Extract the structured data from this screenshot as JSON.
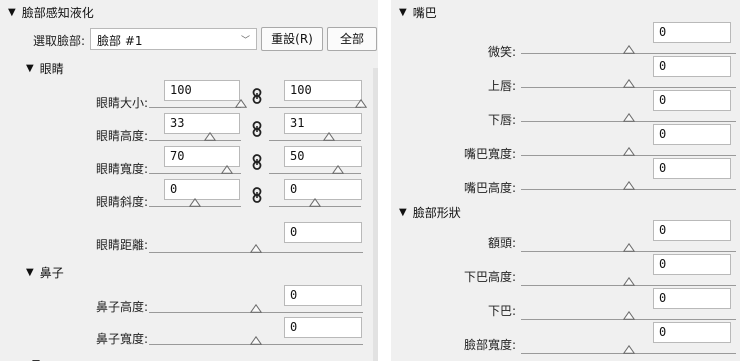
{
  "left": {
    "section_face": "臉部感知液化",
    "select_label": "選取臉部:",
    "select_value": "臉部 #1",
    "reset_button": "重設(R)",
    "all_button": "全部",
    "eyes": {
      "title": "眼睛",
      "rows": [
        {
          "label": "眼睛大小:",
          "left": "100",
          "right": "100",
          "left_level": 1.0,
          "right_level": 1.0
        },
        {
          "label": "眼睛高度:",
          "left": "33",
          "right": "31",
          "left_level": 0.66,
          "right_level": 0.65
        },
        {
          "label": "眼睛寬度:",
          "left": "70",
          "right": "50",
          "left_level": 0.85,
          "right_level": 0.75
        },
        {
          "label": "眼睛斜度:",
          "left": "0",
          "right": "0",
          "left_level": 0.5,
          "right_level": 0.5
        }
      ],
      "distance": {
        "label": "眼睛距離:",
        "value": "0",
        "level": 0.5
      }
    },
    "nose": {
      "title": "鼻子",
      "rows": [
        {
          "label": "鼻子高度:",
          "value": "0",
          "level": 0.5
        },
        {
          "label": "鼻子寬度:",
          "value": "0",
          "level": 0.5
        }
      ]
    }
  },
  "right": {
    "mouth": {
      "title": "嘴巴",
      "rows": [
        {
          "label": "微笑:",
          "value": "0",
          "level": 0.5
        },
        {
          "label": "上唇:",
          "value": "0",
          "level": 0.5
        },
        {
          "label": "下唇:",
          "value": "0",
          "level": 0.5
        },
        {
          "label": "嘴巴寬度:",
          "value": "0",
          "level": 0.5
        },
        {
          "label": "嘴巴高度:",
          "value": "0",
          "level": 0.5
        }
      ]
    },
    "face_shape": {
      "title": "臉部形狀",
      "rows": [
        {
          "label": "額頭:",
          "value": "0",
          "level": 0.5
        },
        {
          "label": "下巴高度:",
          "value": "0",
          "level": 0.5
        },
        {
          "label": "下巴:",
          "value": "0",
          "level": 0.5
        },
        {
          "label": "臉部寬度:",
          "value": "0",
          "level": 0.5
        }
      ]
    }
  },
  "icons": {
    "collapse": "triangle-down-icon",
    "link": "chain-link-icon",
    "dropdown": "chevron-down-icon"
  }
}
